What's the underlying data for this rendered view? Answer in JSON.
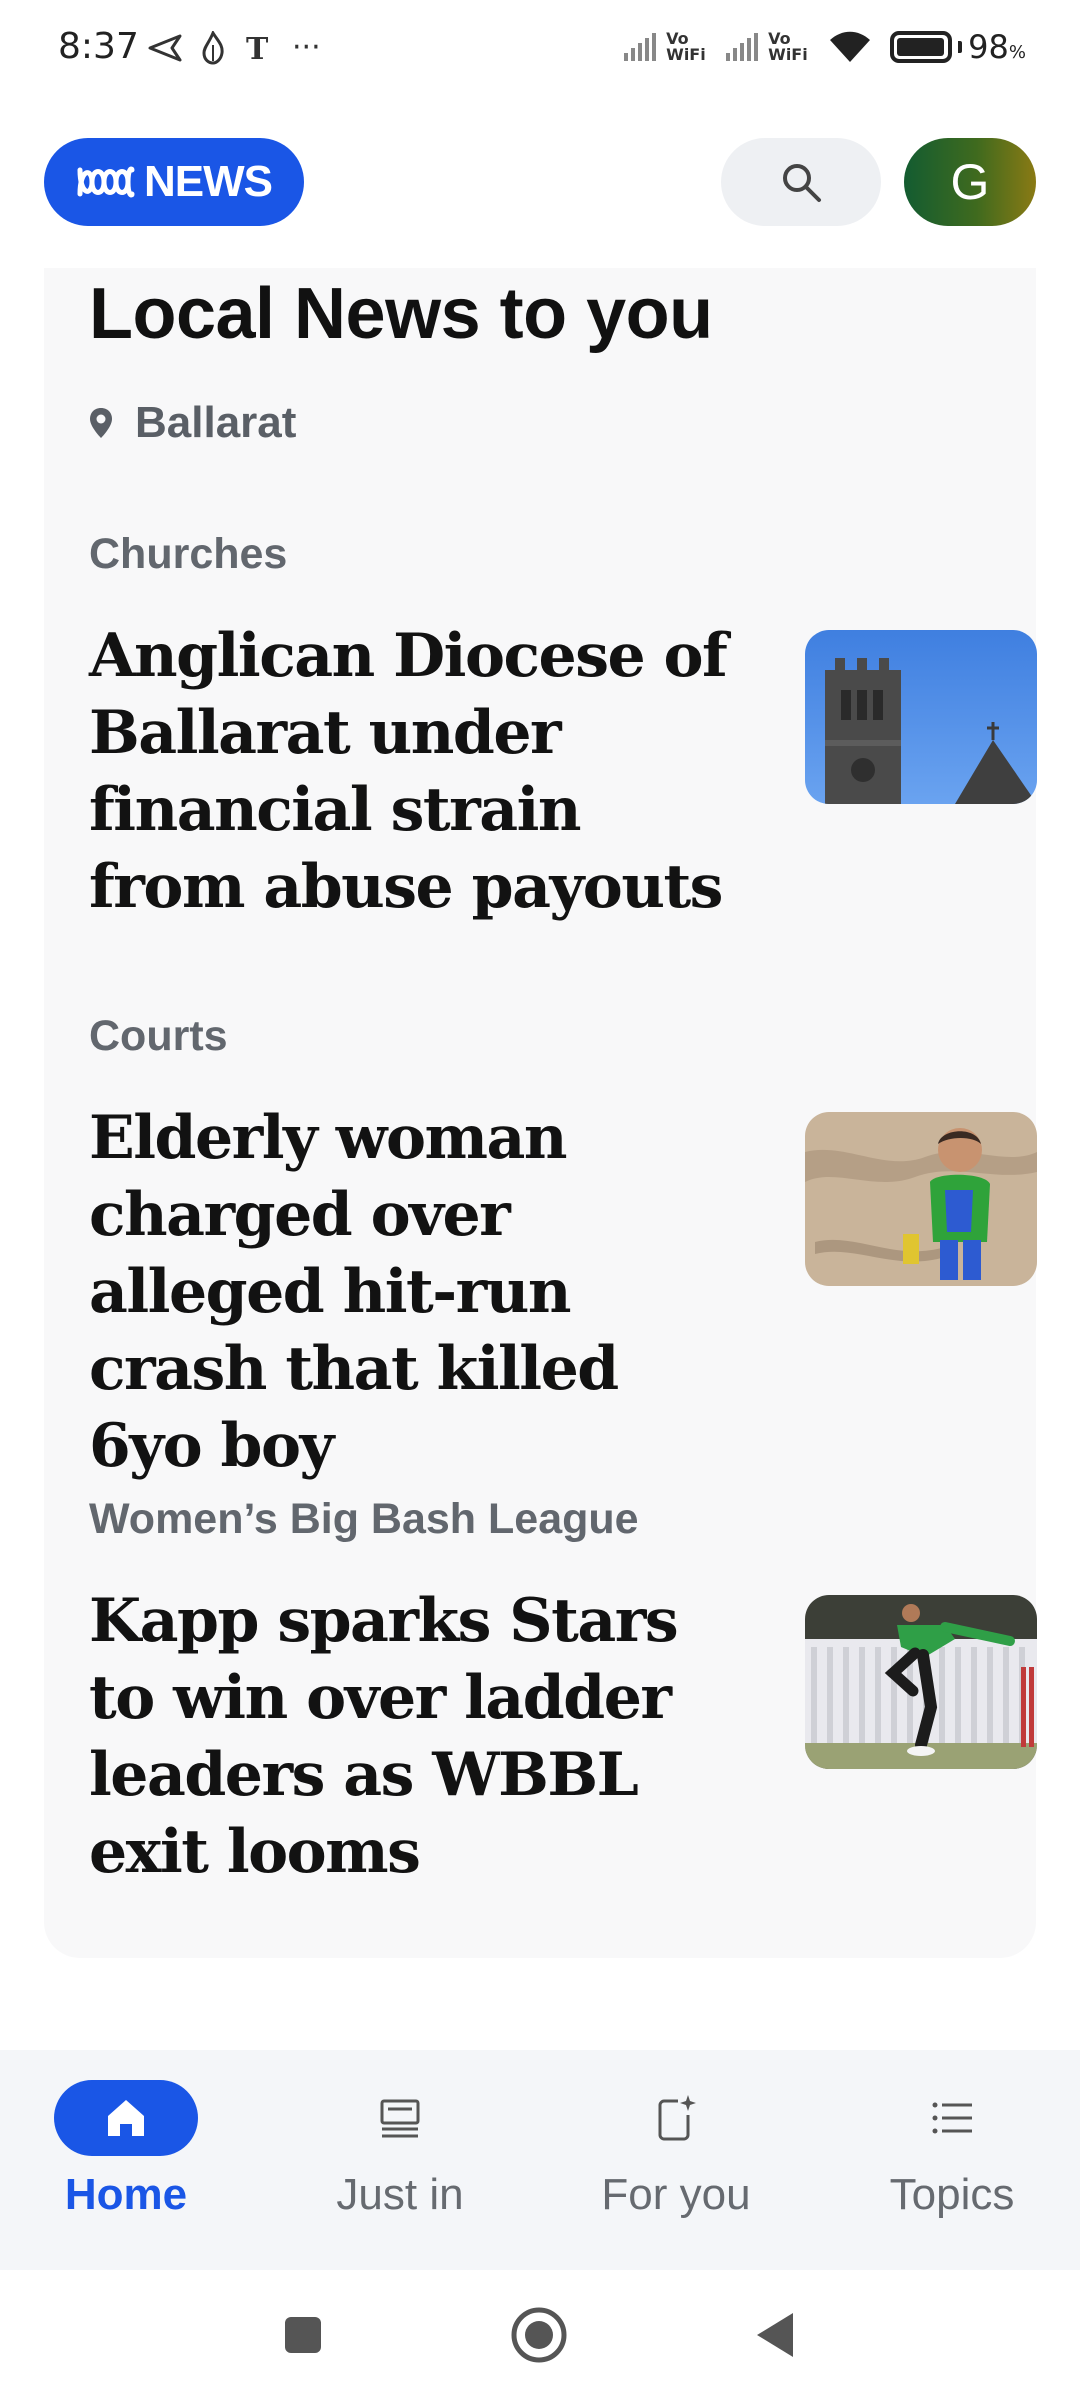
{
  "status_bar": {
    "time": "8:37",
    "left_icons": [
      "navigation-arrow-icon",
      "flame-app-icon",
      "nyt-app-icon",
      "more-dots-icon"
    ],
    "more": "···",
    "vowifi_1": "Vo WiFi",
    "vowifi_2": "Vo WiFi",
    "battery_percent": "98",
    "battery_unit": "%",
    "battery_level": 0.98
  },
  "header": {
    "logo_text": "NEWS",
    "avatar_letter": "G"
  },
  "colors": {
    "brand": "#1a56e6",
    "card_bg": "#f8f8f9",
    "topic_text": "#62676e",
    "nav_bg": "#f4f6f9"
  },
  "local_news": {
    "title": "Local News to you",
    "location": "Ballarat",
    "stories": [
      {
        "topic": "Churches",
        "headline": "Anglican Diocese of Ballarat under financial strain from abuse payouts",
        "thumb": "church-spire-photo"
      },
      {
        "topic": "Courts",
        "headline": "Elderly woman charged over alleged hit-run crash that killed 6yo boy",
        "thumb": "boy-on-beach-photo"
      },
      {
        "topic": "Women’s Big Bash League",
        "headline": "Kapp sparks Stars to win over ladder leaders as WBBL exit looms",
        "thumb": "cricket-bowler-photo"
      }
    ]
  },
  "bottom_nav": {
    "items": [
      {
        "label": "Home",
        "icon": "home-icon",
        "active": true
      },
      {
        "label": "Just in",
        "icon": "just-in-icon",
        "active": false
      },
      {
        "label": "For you",
        "icon": "for-you-icon",
        "active": false
      },
      {
        "label": "Topics",
        "icon": "topics-list-icon",
        "active": false
      }
    ]
  },
  "system_nav": [
    "recents-square-icon",
    "home-circle-icon",
    "back-triangle-icon"
  ]
}
